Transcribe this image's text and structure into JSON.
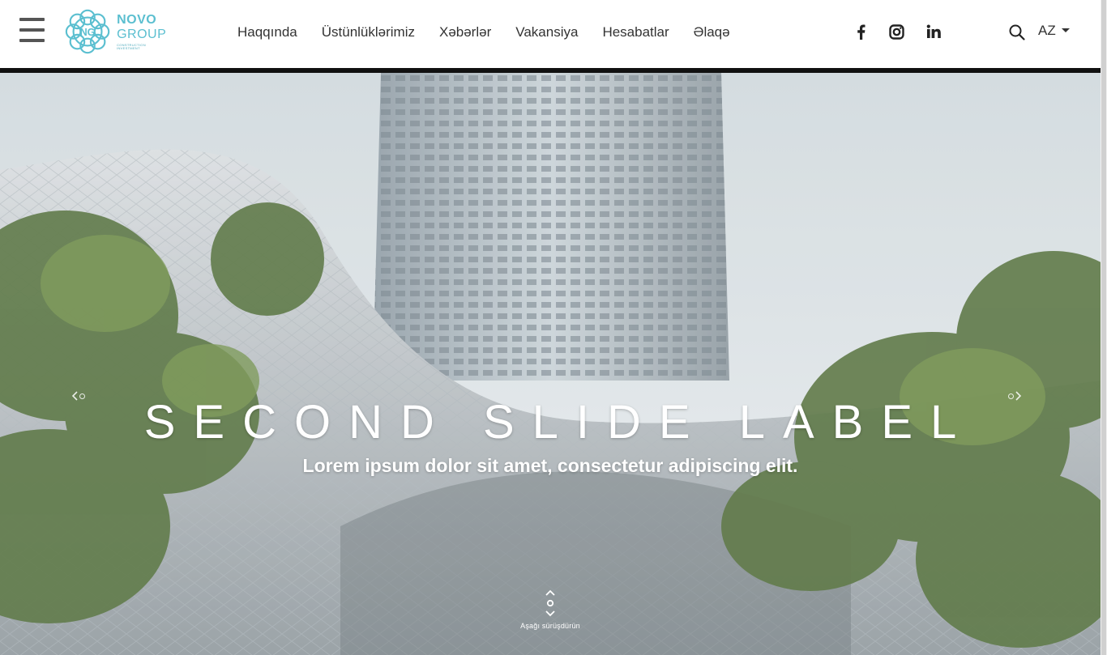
{
  "header": {
    "logo": {
      "line1": "NOVO",
      "line2": "GROUP",
      "tagline": "CONSTRUCTION INVESTMENT"
    },
    "nav": [
      {
        "label": "Haqqında"
      },
      {
        "label": "Üstünlüklərimiz"
      },
      {
        "label": "Xəbərlər"
      },
      {
        "label": "Vakansiya"
      },
      {
        "label": "Hesabatlar"
      },
      {
        "label": "Əlaqə"
      }
    ],
    "social": [
      "facebook-icon",
      "instagram-icon",
      "linkedin-icon"
    ],
    "language": {
      "selected": "AZ"
    }
  },
  "hero": {
    "title": "SECOND SLIDE LABEL",
    "caption": "Lorem ipsum dolor sit amet, consectetur adipiscing elit.",
    "scroll_hint": "Aşağı sürüşdürün"
  },
  "colors": {
    "brand": "#5bbfd0",
    "nav_text": "#333333",
    "icon": "#222222"
  }
}
